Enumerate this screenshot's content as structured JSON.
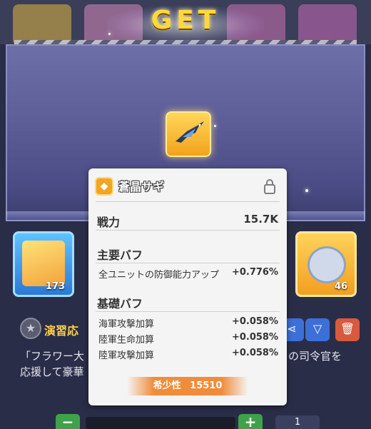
{
  "header": {
    "title": "GET"
  },
  "reward": {
    "item_icon": "gray-heron-icon"
  },
  "card": {
    "name": "蒼晶サギ",
    "icon": "diamond-badge-icon",
    "lock_icon": "lock-icon",
    "power_label": "戦力",
    "power_value": "15.7K",
    "main_buff_title": "主要バフ",
    "main_buffs": [
      {
        "label": "全ユニットの防御能力アップ",
        "value": "+0.776%"
      }
    ],
    "base_buff_title": "基礎バフ",
    "base_buffs": [
      {
        "label": "海軍攻撃加算",
        "value": "+0.058%"
      },
      {
        "label": "陸軍生命加算",
        "value": "+0.058%"
      },
      {
        "label": "陸軍攻撃加算",
        "value": "+0.058%"
      }
    ],
    "rarity_label": "希少性",
    "rarity_value": "15510"
  },
  "background": {
    "slot_left_count": "173",
    "slot_right_count": "46",
    "section_title": "演習応",
    "desc_line1": "「フラワー大",
    "desc_line1_right": "の司令官を",
    "desc_line2": "応援して豪華",
    "quantity": "1"
  },
  "colors": {
    "accent": "#ffd93b",
    "rarity": "#f08c3a"
  }
}
